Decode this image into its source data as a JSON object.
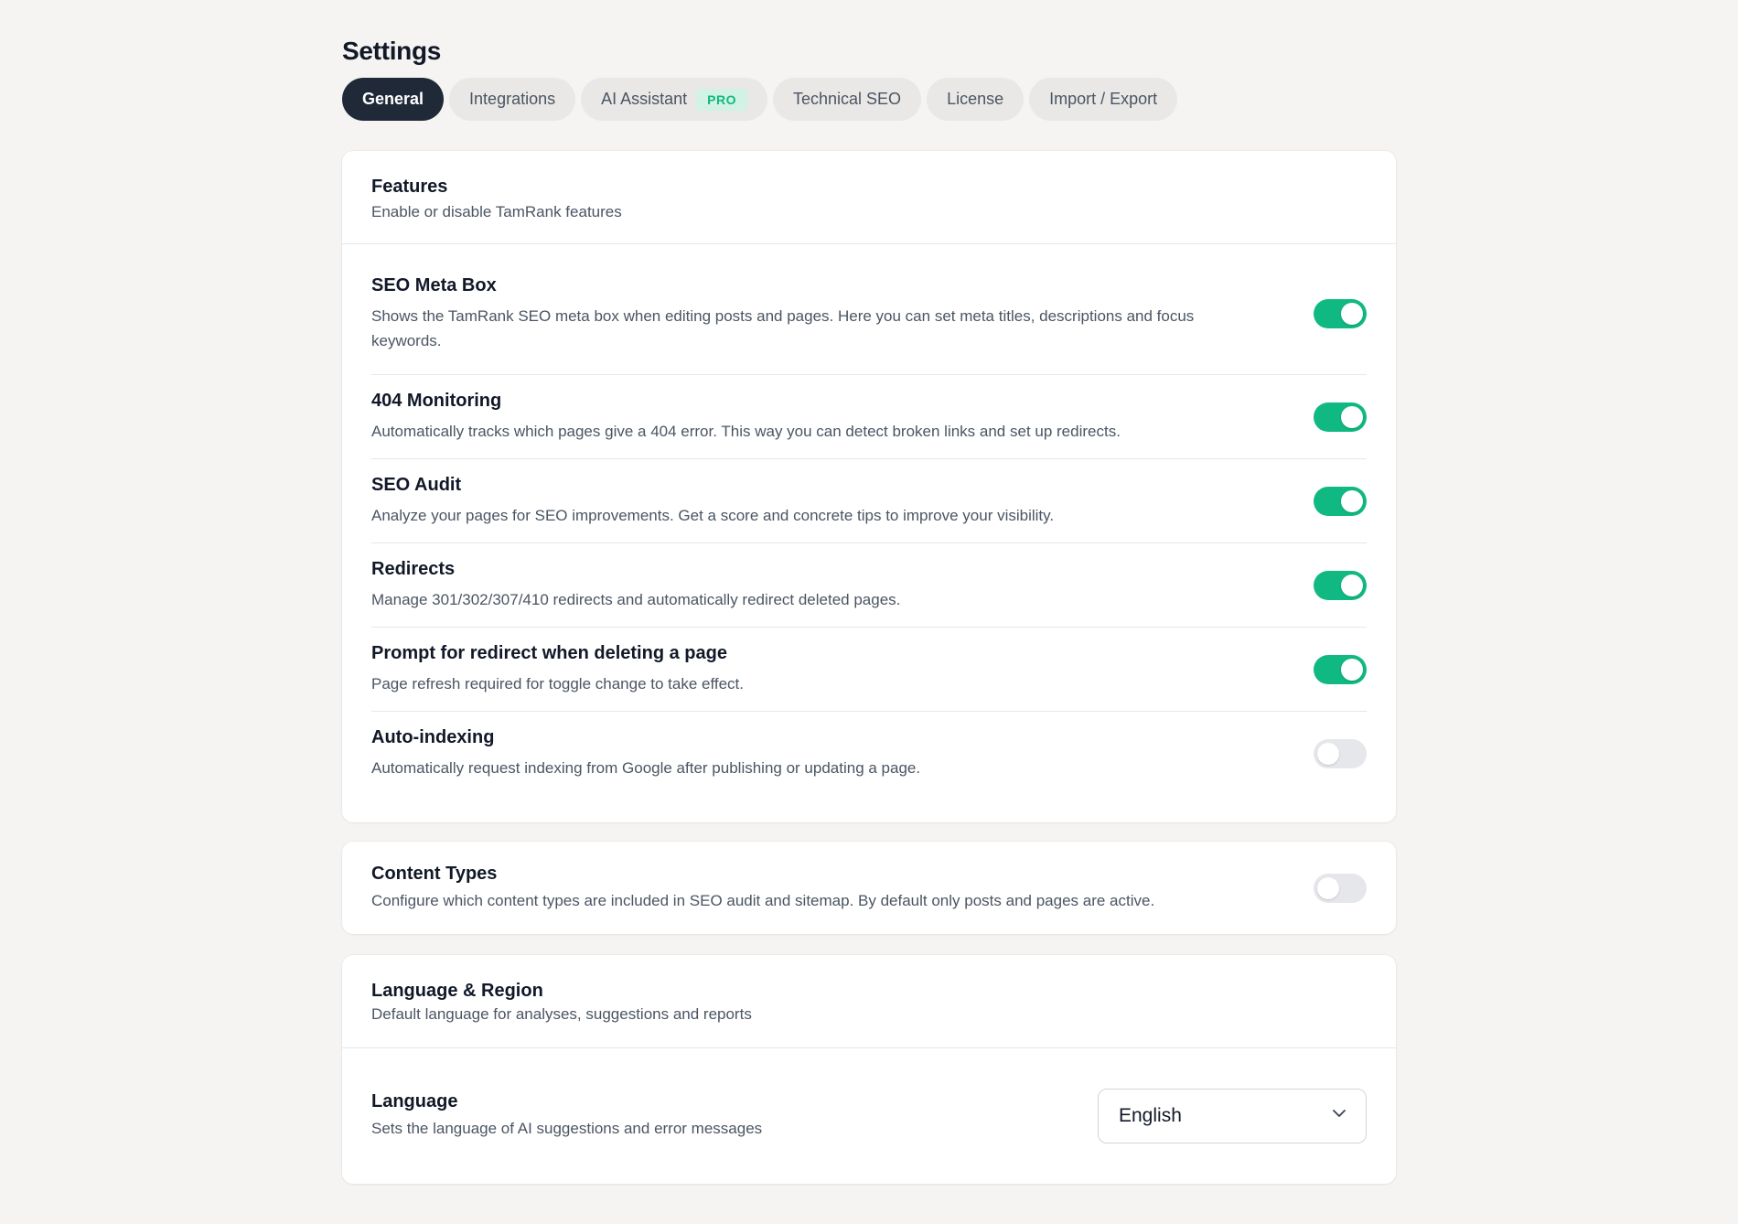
{
  "page": {
    "title": "Settings"
  },
  "tabs": [
    {
      "label": "General",
      "active": true
    },
    {
      "label": "Integrations",
      "active": false
    },
    {
      "label": "AI Assistant",
      "badge": "PRO",
      "active": false
    },
    {
      "label": "Technical SEO",
      "active": false
    },
    {
      "label": "License",
      "active": false
    },
    {
      "label": "Import / Export",
      "active": false
    }
  ],
  "features": {
    "title": "Features",
    "subtitle": "Enable or disable TamRank features",
    "items": [
      {
        "title": "SEO Meta Box",
        "description": "Shows the TamRank SEO meta box when editing posts and pages. Here you can set meta titles, descriptions and focus keywords.",
        "enabled": true
      },
      {
        "title": "404 Monitoring",
        "description": "Automatically tracks which pages give a 404 error. This way you can detect broken links and set up redirects.",
        "enabled": true
      },
      {
        "title": "SEO Audit",
        "description": "Analyze your pages for SEO improvements. Get a score and concrete tips to improve your visibility.",
        "enabled": true
      },
      {
        "title": "Redirects",
        "description": "Manage 301/302/307/410 redirects and automatically redirect deleted pages.",
        "enabled": true
      },
      {
        "title": "Prompt for redirect when deleting a page",
        "description": "Page refresh required for toggle change to take effect.",
        "enabled": true
      },
      {
        "title": "Auto-indexing",
        "description": "Automatically request indexing from Google after publishing or updating a page.",
        "enabled": false
      }
    ]
  },
  "content_types": {
    "title": "Content Types",
    "description": "Configure which content types are included in SEO audit and sitemap. By default only posts and pages are active.",
    "enabled": false
  },
  "language_region": {
    "title": "Language & Region",
    "subtitle": "Default language for analyses, suggestions and reports",
    "language": {
      "title": "Language",
      "description": "Sets the language of AI suggestions and error messages",
      "selected": "English"
    }
  },
  "colors": {
    "accent": "#10b981",
    "active_tab": "#1f2937",
    "toggle_off": "#e5e7eb",
    "background": "#f5f4f2"
  }
}
